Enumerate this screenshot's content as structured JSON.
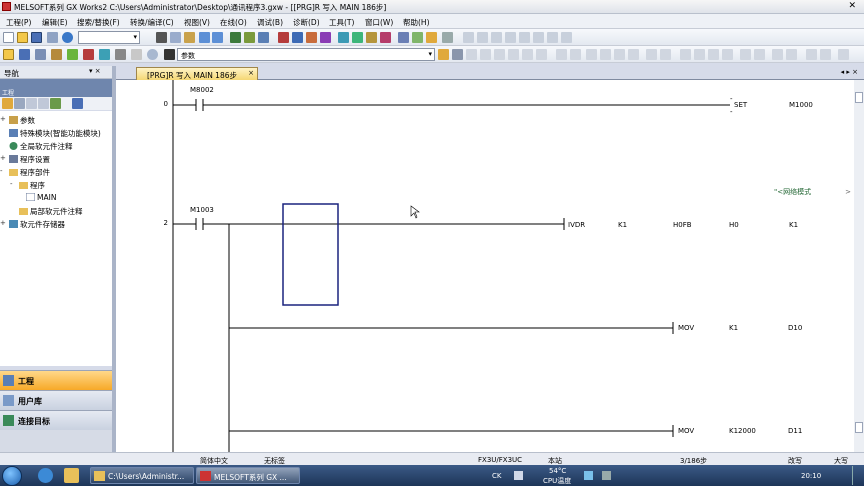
{
  "window": {
    "title": "MELSOFT系列 GX Works2 C:\\Users\\Administrator\\Desktop\\通讯程序3.gxw - [[PRG]R 写入 MAIN 186步]"
  },
  "menu": [
    "工程(P)",
    "编辑(E)",
    "搜索/替换(F)",
    "转换/编译(C)",
    "视图(V)",
    "在线(O)",
    "调试(B)",
    "诊断(D)",
    "工具(T)",
    "窗口(W)",
    "帮助(H)"
  ],
  "toolbar": {
    "combo2_value": "参数"
  },
  "nav": {
    "title": "导航",
    "pin": "▾ ×",
    "sub_label": "工程",
    "tree": [
      {
        "label": "参数",
        "expander": "+",
        "level": 0,
        "icon": "parameter-icon"
      },
      {
        "label": "特殊模块(智能功能模块)",
        "expander": "",
        "level": 0,
        "icon": "module-icon"
      },
      {
        "label": "全局软元件注释",
        "expander": "",
        "level": 0,
        "icon": "comment-icon"
      },
      {
        "label": "程序设置",
        "expander": "+",
        "level": 0,
        "icon": "setting-icon"
      },
      {
        "label": "程序部件",
        "expander": "-",
        "level": 0,
        "icon": "folder-icon"
      },
      {
        "label": "程序",
        "expander": "-",
        "level": 1,
        "icon": "folder-icon"
      },
      {
        "label": "MAIN",
        "expander": "",
        "level": 2,
        "icon": "program-icon"
      },
      {
        "label": "局部软元件注释",
        "expander": "",
        "level": 1,
        "icon": "comment-icon"
      },
      {
        "label": "软元件存储器",
        "expander": "+",
        "level": 0,
        "icon": "memory-icon"
      }
    ],
    "buttons": [
      {
        "label": "工程",
        "active": true,
        "icon": "project-icon"
      },
      {
        "label": "用户库",
        "active": false,
        "icon": "library-icon"
      },
      {
        "label": "连接目标",
        "active": false,
        "icon": "connection-icon"
      }
    ]
  },
  "tab": {
    "label": "[PRG]R 写入 MAIN 186步",
    "close": "×",
    "nav": "◂ ▸ ×"
  },
  "ladder": {
    "rungs": [
      {
        "step": "0",
        "contact": "M8002",
        "instr": "SET",
        "ops": [
          "M1000"
        ]
      },
      {
        "step": "2",
        "contact": "M1003",
        "comment": "\"<网络模式",
        "instr": "IVDR",
        "ops": [
          "K1",
          "H0FB",
          "H0",
          "K1"
        ]
      },
      {
        "instr": "MOV",
        "ops": [
          "K1",
          "D10"
        ]
      },
      {
        "instr": "MOV",
        "ops": [
          "K12000",
          "D11"
        ]
      }
    ]
  },
  "status": {
    "lang": "简体中文",
    "title": "无标签",
    "cpu": "FX3U/FX3UC",
    "station": "本站",
    "steps": "3/186步",
    "mode": "改写",
    "caps": "大写"
  },
  "taskbar": {
    "tasks": [
      {
        "label": "C:\\Users\\Administr...",
        "active": false
      },
      {
        "label": "MELSOFT系列 GX ...",
        "active": true
      }
    ],
    "tray": {
      "ime": "CK",
      "temp": "54°C",
      "cpu": "CPU温度",
      "clock": "20:10"
    }
  }
}
